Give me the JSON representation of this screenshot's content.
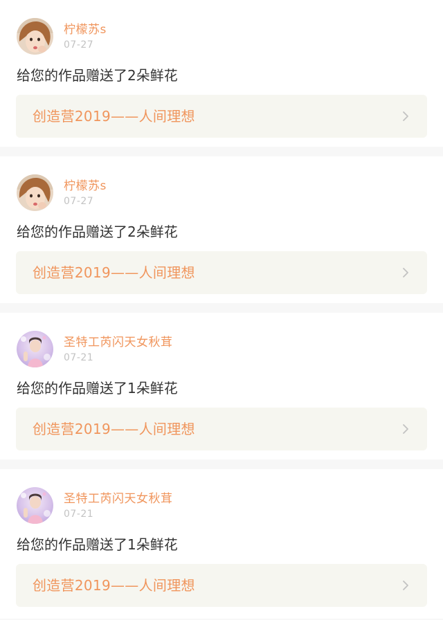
{
  "colors": {
    "accent": "#f0955c",
    "link_bg": "#f6f6f0",
    "chevron": "#c2c2c2"
  },
  "posts": [
    {
      "avatar_icon": "user-avatar-icon",
      "username": "柠檬苏s",
      "date": "07-27",
      "message": "给您的作品赠送了2朵鲜花",
      "work_title": "创造营2019——人间理想",
      "chevron_icon": "chevron-right-icon"
    },
    {
      "avatar_icon": "user-avatar-icon",
      "username": "柠檬苏s",
      "date": "07-27",
      "message": "给您的作品赠送了2朵鲜花",
      "work_title": "创造营2019——人间理想",
      "chevron_icon": "chevron-right-icon"
    },
    {
      "avatar_icon": "user-avatar-icon",
      "username": "圣特工芮闪天女秋茸",
      "date": "07-21",
      "message": "给您的作品赠送了1朵鲜花",
      "work_title": "创造营2019——人间理想",
      "chevron_icon": "chevron-right-icon"
    },
    {
      "avatar_icon": "user-avatar-icon",
      "username": "圣特工芮闪天女秋茸",
      "date": "07-21",
      "message": "给您的作品赠送了1朵鲜花",
      "work_title": "创造营2019——人间理想",
      "chevron_icon": "chevron-right-icon"
    }
  ]
}
